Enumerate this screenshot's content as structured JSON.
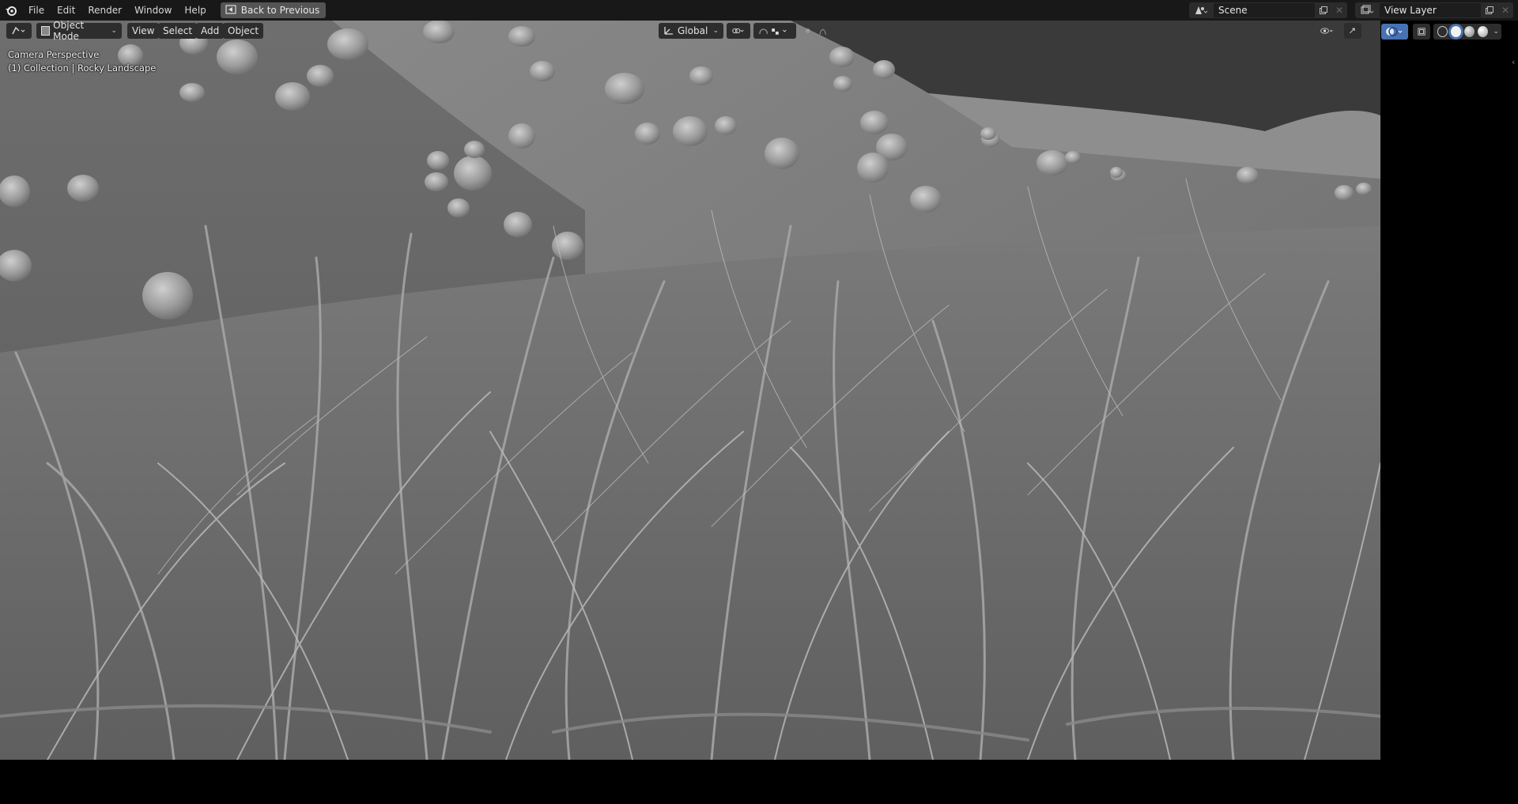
{
  "topbar": {
    "menu": [
      "File",
      "Edit",
      "Render",
      "Window",
      "Help"
    ],
    "back_label": "Back to Previous",
    "scene_name": "Scene",
    "view_layer_name": "View Layer"
  },
  "viewport": {
    "mode_label": "Object Mode",
    "header_menus": [
      "View",
      "Select",
      "Add",
      "Object"
    ],
    "orientation_label": "Global",
    "overlay_line1": "Camera Perspective",
    "overlay_line2": "(1) Collection | Rocky Landscape"
  },
  "colors": {
    "topbar_bg": "#181818",
    "button_bg": "#2d2d2d",
    "accent_blue": "#4772b3",
    "viewport_bg": "#5f5f5f"
  },
  "icons": [
    "blender-logo-icon",
    "back-screen-icon",
    "scene-icon",
    "view-layer-icon",
    "editor-type-icon",
    "object-mode-icon",
    "transform-orientation-icon",
    "pivot-icon",
    "snap-icon",
    "proportional-icon",
    "visibility-icon",
    "gizmo-icon",
    "overlay-icon",
    "xray-icon",
    "wireframe-icon",
    "solid-icon",
    "material-icon",
    "rendered-icon"
  ]
}
